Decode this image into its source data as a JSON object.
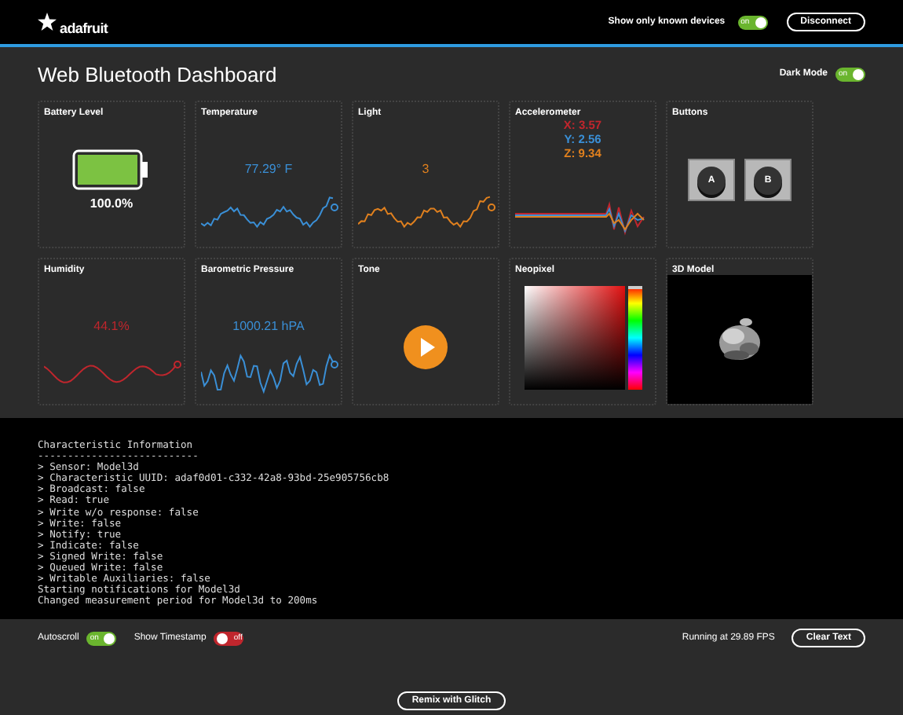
{
  "header": {
    "logo": "adafruit",
    "known_devices": {
      "label": "Show only known devices",
      "on": true,
      "text": "on"
    },
    "disconnect": "Disconnect"
  },
  "title": "Web Bluetooth Dashboard",
  "dark_mode": {
    "label": "Dark Mode",
    "on": true,
    "text": "on"
  },
  "cards": [
    {
      "kind": "battery",
      "title": "Battery Level",
      "level": 1.0,
      "value": "100.0%"
    },
    {
      "kind": "graph",
      "title": "Temperature",
      "value": "77.29° F",
      "color": "#3a8fd6"
    },
    {
      "kind": "graph",
      "title": "Light",
      "value": "3",
      "color": "#e0801e"
    },
    {
      "kind": "accel",
      "title": "Accelerometer",
      "axes": [
        {
          "text": "X: 3.57",
          "color": "#c0262d"
        },
        {
          "text": "Y: 2.56",
          "color": "#3a8fd6"
        },
        {
          "text": "Z: 9.34",
          "color": "#e0801e"
        }
      ]
    },
    {
      "kind": "buttons",
      "title": "Buttons",
      "buttons": [
        "A",
        "B"
      ]
    },
    {
      "kind": "graph",
      "title": "Humidity",
      "value": "44.1%",
      "color": "#c0262d"
    },
    {
      "kind": "graph",
      "title": "Barometric Pressure",
      "value": "1000.21 hPA",
      "color": "#3a8fd6"
    },
    {
      "kind": "tone",
      "title": "Tone"
    },
    {
      "kind": "neopixel",
      "title": "Neopixel",
      "hue": {
        "level": 0
      }
    },
    {
      "kind": "model",
      "title": "3D Model"
    }
  ],
  "console": [
    "Characteristic Information",
    "---------------------------",
    "> Sensor: Model3d",
    "> Characteristic UUID: adaf0d01-c332-42a8-93bd-25e905756cb8",
    "> Broadcast: false",
    "> Read: true",
    "> Write w/o response: false",
    "> Write: false",
    "> Notify: true",
    "> Indicate: false",
    "> Signed Write: false",
    "> Queued Write: false",
    "> Writable Auxiliaries: false",
    "Starting notifications for Model3d",
    "Changed measurement period for Model3d to 200ms"
  ],
  "footer": {
    "toggles": [
      {
        "label": "Autoscroll",
        "on": true,
        "text": "on"
      },
      {
        "label": "Show Timestamp",
        "on": false,
        "text": "off"
      }
    ],
    "fps": "Running at 29.89 FPS",
    "clear": "Clear Text",
    "remix": "Remix with Glitch"
  }
}
